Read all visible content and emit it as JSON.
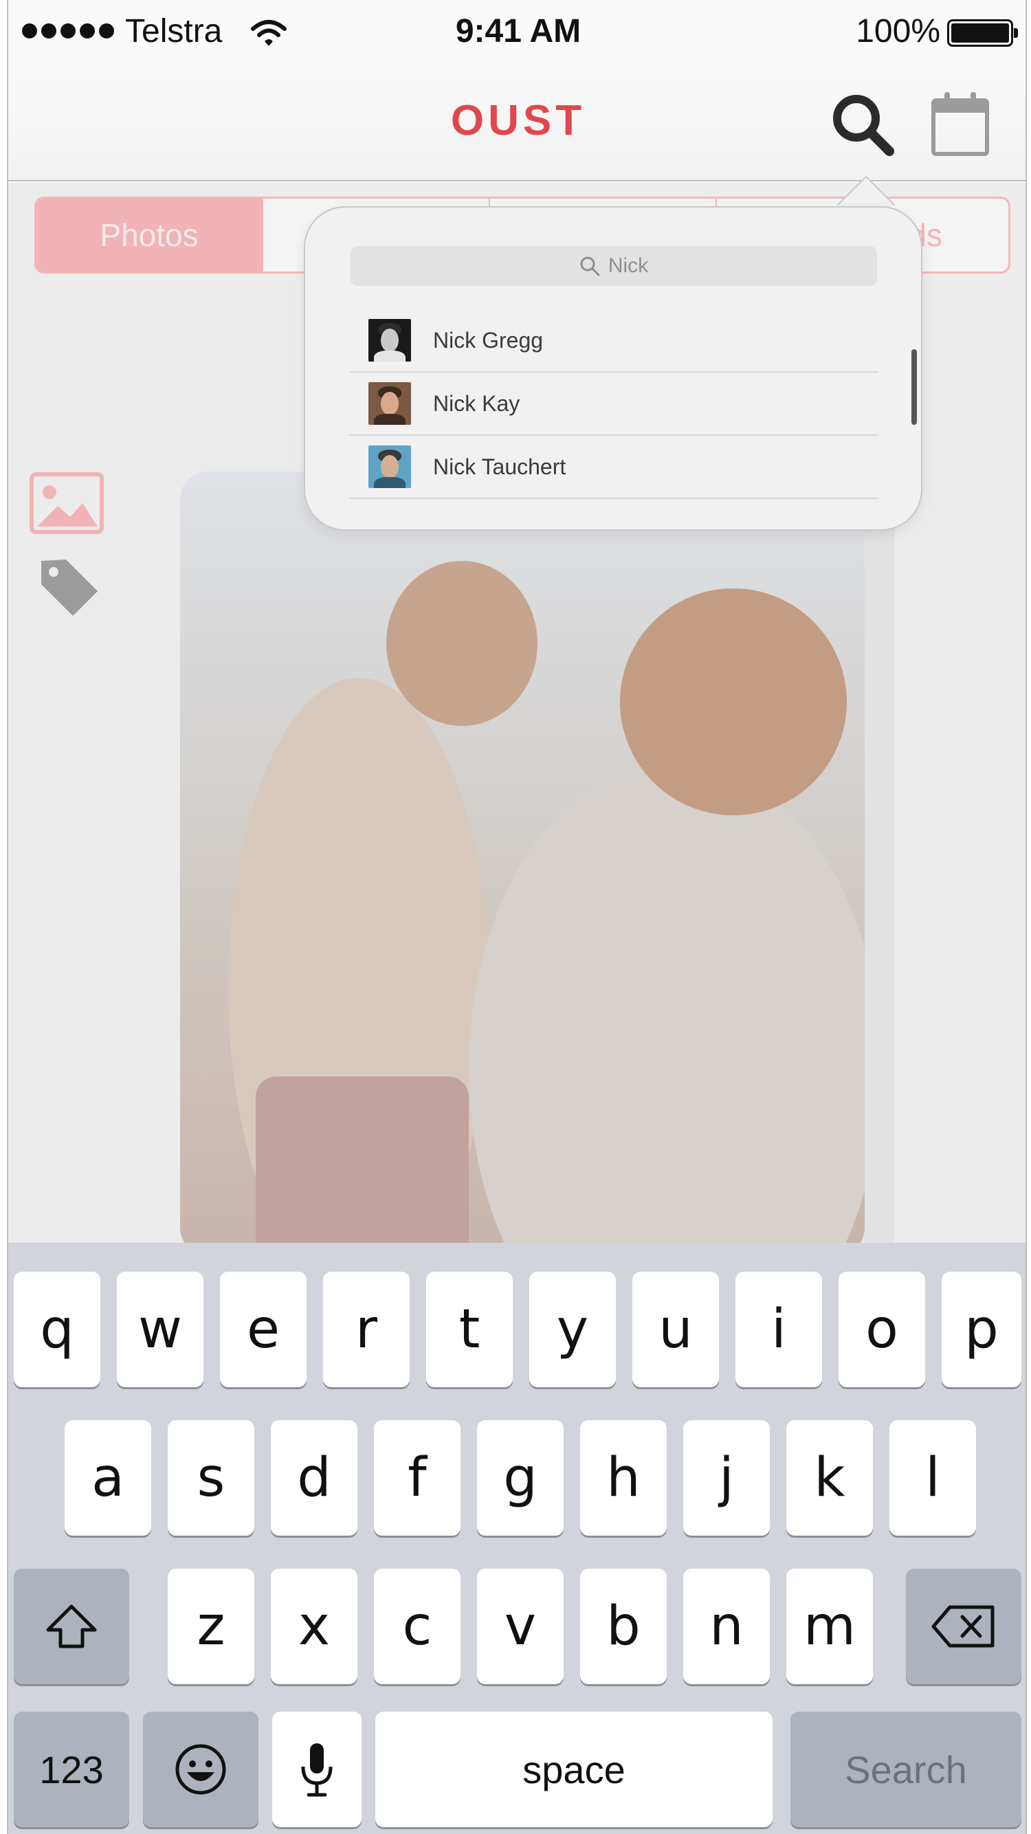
{
  "status_bar": {
    "carrier": "Telstra",
    "time": "9:41 AM",
    "battery": "100%"
  },
  "nav": {
    "logo": "OUST",
    "search_icon": "search-icon",
    "calendar_icon": "calendar-icon"
  },
  "segments": [
    {
      "label": "Photos",
      "active": true
    },
    {
      "label": "",
      "active": false
    },
    {
      "label": "",
      "active": false
    },
    {
      "label": "ds",
      "active": false
    }
  ],
  "search_popover": {
    "placeholder": "Nick",
    "results": [
      {
        "name": "Nick Gregg"
      },
      {
        "name": "Nick Kay"
      },
      {
        "name": "Nick Tauchert"
      }
    ]
  },
  "keyboard": {
    "row1": [
      "q",
      "w",
      "e",
      "r",
      "t",
      "y",
      "u",
      "i",
      "o",
      "p"
    ],
    "row2": [
      "a",
      "s",
      "d",
      "f",
      "g",
      "h",
      "j",
      "k",
      "l"
    ],
    "row3": [
      "z",
      "x",
      "c",
      "v",
      "b",
      "n",
      "m"
    ],
    "numbers_label": "123",
    "space_label": "space",
    "search_label": "Search"
  },
  "colors": {
    "brand": "#e0484c",
    "segment_pink": "#f1b3b6",
    "keyboard_bg": "#d1d4da"
  }
}
